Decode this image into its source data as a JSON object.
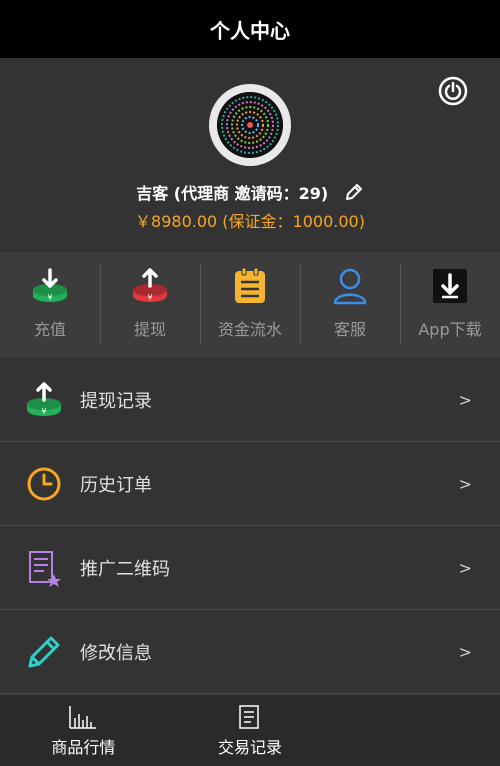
{
  "header": {
    "title": "个人中心"
  },
  "profile": {
    "name_line": "吉客 (代理商 邀请码：29)",
    "balance_line": "￥8980.00 (保证金：1000.00)"
  },
  "quick_actions": [
    {
      "label": "充值",
      "icon": "recharge-icon",
      "color": "#22b35a"
    },
    {
      "label": "提现",
      "icon": "withdraw-icon",
      "color": "#e0393e"
    },
    {
      "label": "资金流水",
      "icon": "ledger-icon",
      "color": "#f5b52e"
    },
    {
      "label": "客服",
      "icon": "user-icon",
      "color": "#3a8fe8"
    },
    {
      "label": "App下载",
      "icon": "download-icon",
      "color": "#111111"
    }
  ],
  "menu": [
    {
      "label": "提现记录",
      "icon": "withdraw-record-icon",
      "arrow": ">"
    },
    {
      "label": "历史订单",
      "icon": "clock-icon",
      "arrow": ">"
    },
    {
      "label": "推广二维码",
      "icon": "qrcode-doc-icon",
      "arrow": ">"
    },
    {
      "label": "修改信息",
      "icon": "pencil-icon",
      "arrow": ">"
    }
  ],
  "bottom_nav": [
    {
      "label": "商品行情",
      "icon": "chart-icon"
    },
    {
      "label": "交易记录",
      "icon": "records-icon"
    }
  ],
  "colors": {
    "accent_gold": "#f5a623",
    "topbar": "#000000"
  }
}
